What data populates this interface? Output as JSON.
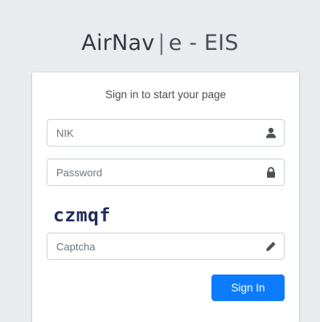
{
  "brand": {
    "name": "AirNav",
    "separator": "|",
    "suffix": "e - EIS"
  },
  "login": {
    "message": "Sign in to start your page",
    "nik_placeholder": "NIK",
    "password_placeholder": "Password",
    "captcha_text": "czmqf",
    "captcha_placeholder": "Captcha",
    "submit_label": "Sign In"
  },
  "icons": {
    "nik": "user-icon",
    "password": "lock-icon",
    "captcha": "pencil-icon"
  },
  "colors": {
    "background": "#e9ecef",
    "primary": "#0d7bfd",
    "captcha": "#1f2d5c"
  }
}
